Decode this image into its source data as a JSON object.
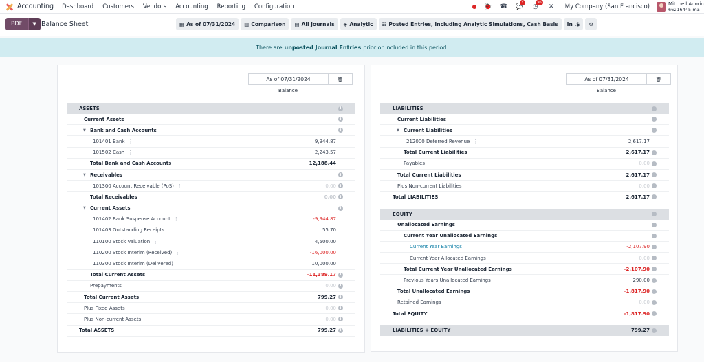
{
  "navbar": {
    "app_name": "Accounting",
    "menu": [
      "Dashboard",
      "Customers",
      "Vendors",
      "Accounting",
      "Reporting",
      "Configuration"
    ],
    "badges": {
      "chat": "7",
      "activities": "36"
    },
    "company": "My Company (San Francisco)",
    "user_name": "Mitchell Admin",
    "user_db": "66216445-ma"
  },
  "control": {
    "pdf_label": "PDF",
    "title": "Balance Sheet",
    "filters": {
      "date": "As of 07/31/2024",
      "comparison": "Comparison",
      "journals": "All Journals",
      "analytic": "Analytic",
      "options": "Posted Entries, Including Analytic Simulations, Cash Basis",
      "currency": "In .$"
    }
  },
  "alert": {
    "before": "There are",
    "bold": "unposted Journal Entries",
    "after": "prior or included in this period."
  },
  "columns": {
    "date": "As of 07/31/2024",
    "sub": "Balance"
  },
  "left_rows": [
    {
      "label": "ASSETS",
      "value": "",
      "type": "section",
      "indent": 18,
      "info": true
    },
    {
      "label": "Current Assets",
      "value": "",
      "type": "bold",
      "indent": 25,
      "info": true
    },
    {
      "label": "Bank and Cash Accounts",
      "value": "",
      "type": "bold",
      "indent": 34,
      "caret": true,
      "info": true
    },
    {
      "label": "101401 Bank",
      "value": "9,944.87",
      "type": "normal",
      "indent": 38,
      "dots": true
    },
    {
      "label": "101502 Cash",
      "value": "2,243.57",
      "type": "normal",
      "indent": 38,
      "dots": true
    },
    {
      "label": "Total Bank and Cash Accounts",
      "value": "12,188.44",
      "type": "bold",
      "indent": 34
    },
    {
      "label": "Receivables",
      "value": "",
      "type": "bold",
      "indent": 34,
      "caret": true,
      "info": true
    },
    {
      "label": "101300 Account Receivable (PoS)",
      "value": "0.00",
      "type": "normal",
      "indent": 38,
      "dots": true,
      "zero": true,
      "info": true
    },
    {
      "label": "Total Receivables",
      "value": "0.00",
      "type": "bold",
      "indent": 34,
      "zero": true,
      "info": true
    },
    {
      "label": "Current Assets",
      "value": "",
      "type": "bold",
      "indent": 34,
      "caret": true,
      "info": true
    },
    {
      "label": "101402 Bank Suspense Account",
      "value": "-9,944.87",
      "type": "normal",
      "indent": 38,
      "dots": true,
      "neg": true
    },
    {
      "label": "101403 Outstanding Receipts",
      "value": "55.70",
      "type": "normal",
      "indent": 38,
      "dots": true
    },
    {
      "label": "110100 Stock Valuation",
      "value": "4,500.00",
      "type": "normal",
      "indent": 38,
      "dots": true
    },
    {
      "label": "110200 Stock Interim (Received)",
      "value": "-16,000.00",
      "type": "normal",
      "indent": 38,
      "dots": true,
      "neg": true
    },
    {
      "label": "110300 Stock Interim (Delivered)",
      "value": "10,000.00",
      "type": "normal",
      "indent": 38,
      "dots": true
    },
    {
      "label": "Total Current Assets",
      "value": "-11,389.17",
      "type": "bold",
      "indent": 34,
      "neg": true,
      "info": true
    },
    {
      "label": "Prepayments",
      "value": "0.00",
      "type": "normal",
      "indent": 34,
      "zero": true,
      "info": true
    },
    {
      "label": "Total Current Assets",
      "value": "799.27",
      "type": "bold",
      "indent": 25,
      "info": true
    },
    {
      "label": "Plus Fixed Assets",
      "value": "0.00",
      "type": "normal",
      "indent": 25,
      "zero": true,
      "info": true
    },
    {
      "label": "Plus Non-current Assets",
      "value": "0.00",
      "type": "normal",
      "indent": 25,
      "zero": true,
      "info": true
    },
    {
      "label": "Total ASSETS",
      "value": "799.27",
      "type": "bold",
      "indent": 18,
      "info": true
    }
  ],
  "right_rows": [
    {
      "label": "LIABILITIES",
      "value": "",
      "type": "section",
      "indent": 18,
      "info": true
    },
    {
      "label": "Current Liabilities",
      "value": "",
      "type": "bold",
      "indent": 25,
      "info": true
    },
    {
      "label": "Current Liabilities",
      "value": "",
      "type": "bold",
      "indent": 34,
      "caret": true,
      "info": true
    },
    {
      "label": "212000 Deferred Revenue",
      "value": "2,617.17",
      "type": "normal",
      "indent": 38,
      "dots": true
    },
    {
      "label": "Total Current Liabilities",
      "value": "2,617.17",
      "type": "bold",
      "indent": 34,
      "info": true
    },
    {
      "label": "Payables",
      "value": "0.00",
      "type": "normal",
      "indent": 34,
      "zero": true,
      "info": true
    },
    {
      "label": "Total Current Liabilities",
      "value": "2,617.17",
      "type": "bold",
      "indent": 25,
      "info": true
    },
    {
      "label": "Plus Non-current Liabilities",
      "value": "0.00",
      "type": "normal",
      "indent": 25,
      "zero": true,
      "info": true
    },
    {
      "label": "Total LIABILITIES",
      "value": "2,617.17",
      "type": "bold",
      "indent": 18,
      "info": true
    },
    {
      "type": "spacer"
    },
    {
      "label": "EQUITY",
      "value": "",
      "type": "section",
      "indent": 18,
      "info": true
    },
    {
      "label": "Unallocated Earnings",
      "value": "",
      "type": "bold",
      "indent": 25,
      "info": true
    },
    {
      "label": "Current Year Unallocated Earnings",
      "value": "",
      "type": "bold",
      "indent": 34,
      "info": true
    },
    {
      "label": "Current Year Earnings",
      "value": "-2,107.90",
      "type": "normal",
      "indent": 43,
      "neg": true,
      "link": true,
      "info": true
    },
    {
      "label": "Current Year Allocated Earnings",
      "value": "0.00",
      "type": "normal",
      "indent": 43,
      "zero": true,
      "info": true
    },
    {
      "label": "Total Current Year Unallocated Earnings",
      "value": "-2,107.90",
      "type": "bold",
      "indent": 34,
      "neg": true,
      "info": true
    },
    {
      "label": "Previous Years Unallocated Earnings",
      "value": "290.00",
      "type": "normal",
      "indent": 34,
      "info": true
    },
    {
      "label": "Total Unallocated Earnings",
      "value": "-1,817.90",
      "type": "bold",
      "indent": 25,
      "neg": true,
      "info": true
    },
    {
      "label": "Retained Earnings",
      "value": "0.00",
      "type": "normal",
      "indent": 25,
      "zero": true,
      "info": true
    },
    {
      "label": "Total EQUITY",
      "value": "-1,817.90",
      "type": "bold",
      "indent": 18,
      "neg": true,
      "info": true
    },
    {
      "type": "spacer"
    },
    {
      "label": "LIABILITIES + EQUITY",
      "value": "799.27",
      "type": "section",
      "indent": 18,
      "info": true
    }
  ]
}
